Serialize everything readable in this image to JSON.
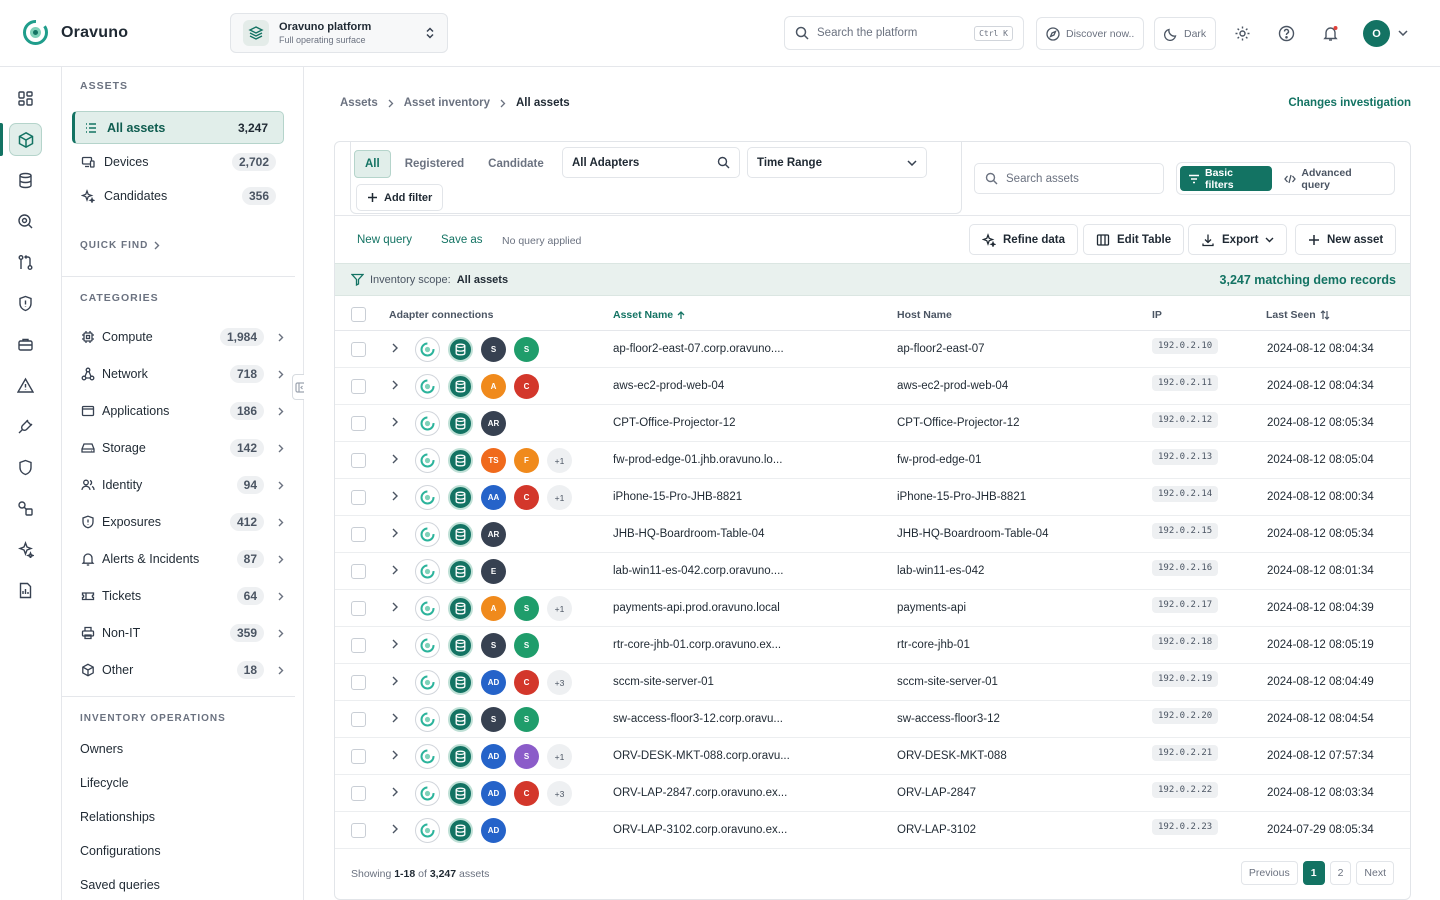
{
  "app": {
    "name": "Oravuno"
  },
  "platform": {
    "title": "Oravuno platform",
    "subtitle": "Full operating surface"
  },
  "search": {
    "placeholder": "Search the platform",
    "shortcut": "Ctrl K"
  },
  "topbar": {
    "discover_label": "Discover now..",
    "theme_label": "Dark",
    "avatar_initial": "O"
  },
  "sidebar": {
    "assets_heading": "ASSETS",
    "items": [
      {
        "label": "All assets",
        "count": "3,247",
        "icon": "list-icon"
      },
      {
        "label": "Devices",
        "count": "2,702",
        "icon": "devices-icon"
      },
      {
        "label": "Candidates",
        "count": "356",
        "icon": "sparkle-icon"
      }
    ],
    "quick_find": "QUICK FIND",
    "categories_heading": "CATEGORIES",
    "categories": [
      {
        "label": "Compute",
        "count": "1,984",
        "icon": "chip-icon"
      },
      {
        "label": "Network",
        "count": "718",
        "icon": "network-icon"
      },
      {
        "label": "Applications",
        "count": "186",
        "icon": "window-icon"
      },
      {
        "label": "Storage",
        "count": "142",
        "icon": "drive-icon"
      },
      {
        "label": "Identity",
        "count": "94",
        "icon": "users-icon"
      },
      {
        "label": "Exposures",
        "count": "412",
        "icon": "shield-alert-icon"
      },
      {
        "label": "Alerts & Incidents",
        "count": "87",
        "icon": "bell-icon"
      },
      {
        "label": "Tickets",
        "count": "64",
        "icon": "ticket-icon"
      },
      {
        "label": "Non-IT",
        "count": "359",
        "icon": "printer-icon"
      },
      {
        "label": "Other",
        "count": "18",
        "icon": "box-icon"
      }
    ],
    "operations_heading": "INVENTORY OPERATIONS",
    "operations": [
      "Owners",
      "Lifecycle",
      "Relationships",
      "Configurations",
      "Saved queries"
    ]
  },
  "breadcrumb": {
    "items": [
      "Assets",
      "Asset inventory",
      "All assets"
    ],
    "action": "Changes investigation"
  },
  "filters": {
    "segments": [
      "All",
      "Registered",
      "Candidate"
    ],
    "adapters_label": "All Adapters",
    "time_range_label": "Time Range",
    "add_filter_label": "Add filter",
    "search_placeholder": "Search assets",
    "basic_label": "Basic filters",
    "advanced_label": "Advanced query"
  },
  "toolbar": {
    "new_query": "New query",
    "save_as": "Save as",
    "note": "No query applied",
    "refine": "Refine data",
    "edit_table": "Edit Table",
    "export": "Export",
    "new_asset": "New asset"
  },
  "scope": {
    "label": "Inventory scope:",
    "value": "All assets",
    "matches": "3,247 matching demo records"
  },
  "table": {
    "columns": {
      "adapters": "Adapter connections",
      "asset_name": "Asset Name",
      "host_name": "Host Name",
      "ip": "IP",
      "last_seen": "Last Seen"
    },
    "rows": [
      {
        "asset": "ap-floor2-east-07.corp.oravuno....",
        "host": "ap-floor2-east-07",
        "ip": "192.0.2.10",
        "seen": "2024-08-12 08:04:34",
        "adapters": [
          {
            "t": "S",
            "c": "#374151"
          },
          {
            "t": "S",
            "c": "#1f9d6b"
          }
        ],
        "more": ""
      },
      {
        "asset": "aws-ec2-prod-web-04",
        "host": "aws-ec2-prod-web-04",
        "ip": "192.0.2.11",
        "seen": "2024-08-12 08:04:34",
        "adapters": [
          {
            "t": "A",
            "c": "#f08a1c"
          },
          {
            "t": "C",
            "c": "#d3372b"
          }
        ],
        "more": ""
      },
      {
        "asset": "CPT-Office-Projector-12",
        "host": "CPT-Office-Projector-12",
        "ip": "192.0.2.12",
        "seen": "2024-08-12 08:05:34",
        "adapters": [
          {
            "t": "AR",
            "c": "#374151"
          }
        ],
        "more": ""
      },
      {
        "asset": "fw-prod-edge-01.jhb.oravuno.lo...",
        "host": "fw-prod-edge-01",
        "ip": "192.0.2.13",
        "seen": "2024-08-12 08:05:04",
        "adapters": [
          {
            "t": "TS",
            "c": "#f06a1c"
          },
          {
            "t": "F",
            "c": "#f08a1c"
          }
        ],
        "more": "+1"
      },
      {
        "asset": "iPhone-15-Pro-JHB-8821",
        "host": "iPhone-15-Pro-JHB-8821",
        "ip": "192.0.2.14",
        "seen": "2024-08-12 08:00:34",
        "adapters": [
          {
            "t": "AA",
            "c": "#2563c9"
          },
          {
            "t": "C",
            "c": "#d3372b"
          }
        ],
        "more": "+1"
      },
      {
        "asset": "JHB-HQ-Boardroom-Table-04",
        "host": "JHB-HQ-Boardroom-Table-04",
        "ip": "192.0.2.15",
        "seen": "2024-08-12 08:05:34",
        "adapters": [
          {
            "t": "AR",
            "c": "#374151"
          }
        ],
        "more": ""
      },
      {
        "asset": "lab-win11-es-042.corp.oravuno....",
        "host": "lab-win11-es-042",
        "ip": "192.0.2.16",
        "seen": "2024-08-12 08:01:34",
        "adapters": [
          {
            "t": "E",
            "c": "#374151"
          }
        ],
        "more": ""
      },
      {
        "asset": "payments-api.prod.oravuno.local",
        "host": "payments-api",
        "ip": "192.0.2.17",
        "seen": "2024-08-12 08:04:39",
        "adapters": [
          {
            "t": "A",
            "c": "#f08a1c"
          },
          {
            "t": "S",
            "c": "#1f9d6b"
          }
        ],
        "more": "+1"
      },
      {
        "asset": "rtr-core-jhb-01.corp.oravuno.ex...",
        "host": "rtr-core-jhb-01",
        "ip": "192.0.2.18",
        "seen": "2024-08-12 08:05:19",
        "adapters": [
          {
            "t": "S",
            "c": "#374151"
          },
          {
            "t": "S",
            "c": "#1f9d6b"
          }
        ],
        "more": ""
      },
      {
        "asset": "sccm-site-server-01",
        "host": "sccm-site-server-01",
        "ip": "192.0.2.19",
        "seen": "2024-08-12 08:04:49",
        "adapters": [
          {
            "t": "AD",
            "c": "#2563c9"
          },
          {
            "t": "C",
            "c": "#d3372b"
          }
        ],
        "more": "+3"
      },
      {
        "asset": "sw-access-floor3-12.corp.oravu...",
        "host": "sw-access-floor3-12",
        "ip": "192.0.2.20",
        "seen": "2024-08-12 08:04:54",
        "adapters": [
          {
            "t": "S",
            "c": "#374151"
          },
          {
            "t": "S",
            "c": "#1f9d6b"
          }
        ],
        "more": ""
      },
      {
        "asset": "ORV-DESK-MKT-088.corp.oravu...",
        "host": "ORV-DESK-MKT-088",
        "ip": "192.0.2.21",
        "seen": "2024-08-12 07:57:34",
        "adapters": [
          {
            "t": "AD",
            "c": "#2563c9"
          },
          {
            "t": "S",
            "c": "#8b5cc9"
          }
        ],
        "more": "+1"
      },
      {
        "asset": "ORV-LAP-2847.corp.oravuno.ex...",
        "host": "ORV-LAP-2847",
        "ip": "192.0.2.22",
        "seen": "2024-08-12 08:03:34",
        "adapters": [
          {
            "t": "AD",
            "c": "#2563c9"
          },
          {
            "t": "C",
            "c": "#d3372b"
          }
        ],
        "more": "+3"
      },
      {
        "asset": "ORV-LAP-3102.corp.oravuno.ex...",
        "host": "ORV-LAP-3102",
        "ip": "192.0.2.23",
        "seen": "2024-07-29 08:05:34",
        "adapters": [
          {
            "t": "AD",
            "c": "#2563c9"
          }
        ],
        "more": ""
      }
    ]
  },
  "footer": {
    "prefix": "Showing",
    "range": "1-18",
    "of": "of",
    "total": "3,247",
    "suffix": "assets"
  },
  "pagination": {
    "previous": "Previous",
    "pages": [
      "1",
      "2"
    ],
    "next": "Next"
  },
  "colors": {
    "accent": "#137363",
    "accent_light": "#e1eeea"
  }
}
